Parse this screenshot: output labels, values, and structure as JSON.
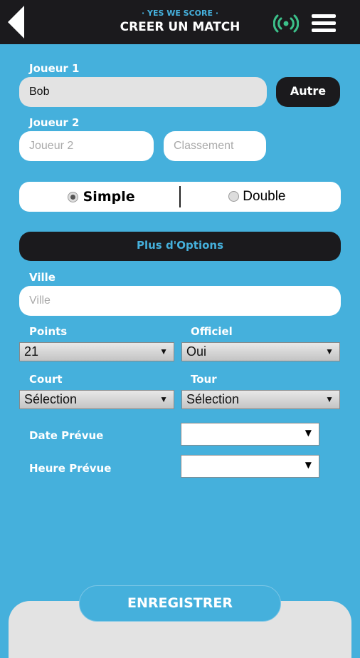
{
  "header": {
    "subtitle": "· YES WE SCORE ·",
    "title": "CREER UN MATCH",
    "back_icon": "back-arrow-icon",
    "signal_icon": "broadcast-icon",
    "menu_icon": "hamburger-icon",
    "signal_color": "#3cc08a"
  },
  "form": {
    "player1_label": "Joueur 1",
    "player1_value": "Bob",
    "other_button": "Autre",
    "player2_label": "Joueur 2",
    "player2_placeholder": "Joueur 2",
    "ranking_placeholder": "Classement",
    "match_type": {
      "options": [
        "Simple",
        "Double"
      ],
      "selected": "Simple"
    },
    "more_options": "Plus d'Options",
    "city_label": "Ville",
    "city_placeholder": "Ville",
    "points_label": "Points",
    "points_value": "21",
    "official_label": "Officiel",
    "official_value": "Oui",
    "court_label": "Court",
    "court_value": "Sélection",
    "round_label": "Tour",
    "round_value": "Sélection",
    "date_label": "Date Prévue",
    "time_label": "Heure Prévue",
    "save_button": "ENREGISTRER"
  },
  "colors": {
    "background": "#45b0dc",
    "dark": "#1b1a1d"
  }
}
